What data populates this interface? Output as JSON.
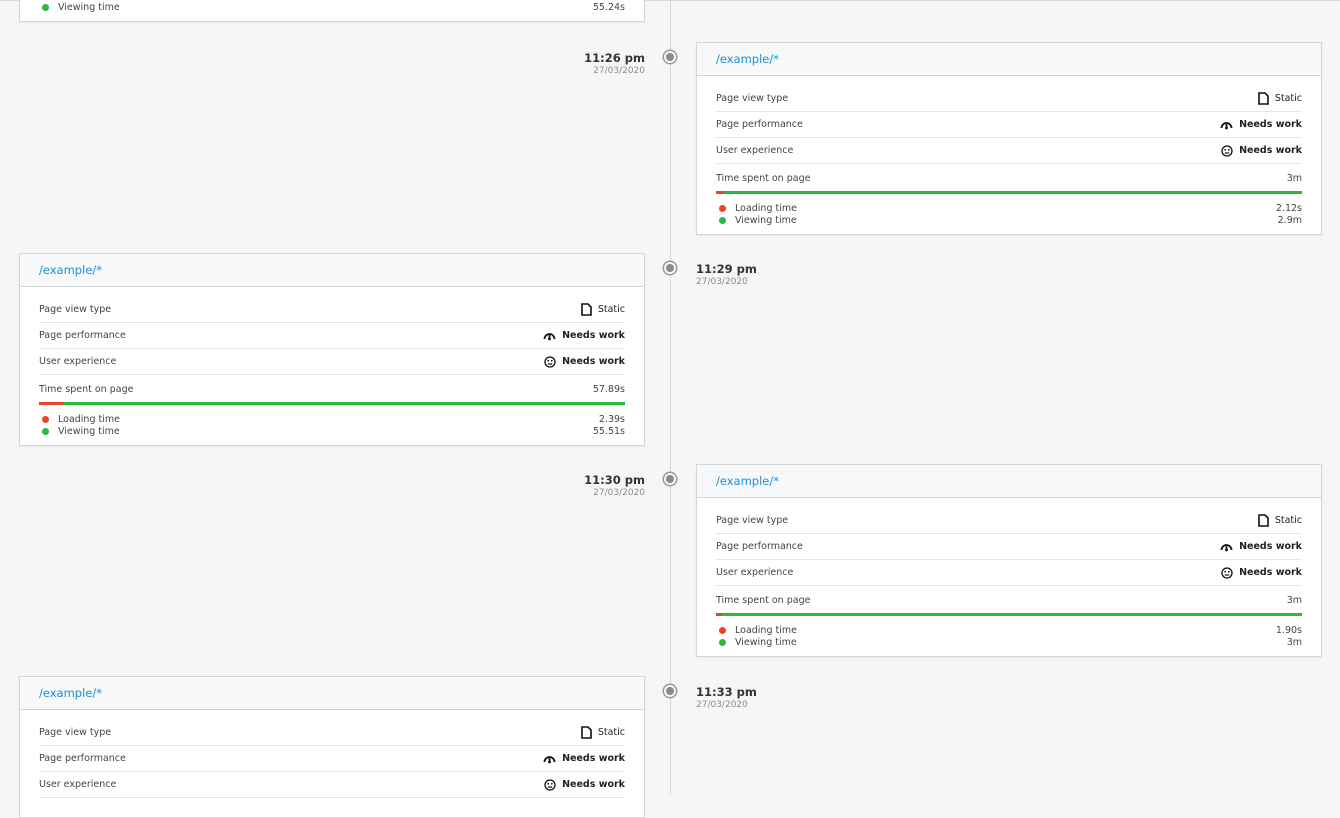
{
  "colors": {
    "link": "#1d8fd6",
    "loading": "#e8442e",
    "viewing": "#2db83d"
  },
  "labels": {
    "page_view_type": "Page view type",
    "page_performance": "Page performance",
    "user_experience": "User experience",
    "time_spent": "Time spent on page",
    "loading_time": "Loading time",
    "viewing_time": "Viewing time"
  },
  "entries": [
    {
      "time": "",
      "date": "",
      "viewing_time": "55.24s"
    },
    {
      "time": "11:26 pm",
      "date": "27/03/2020",
      "url": "/example/*",
      "page_view_type": "Static",
      "page_view_type_icon": "document-icon",
      "page_performance": "Needs work",
      "page_performance_icon": "speedometer-icon",
      "user_experience": "Needs work",
      "user_experience_icon": "neutral-face-icon",
      "time_spent": "3m",
      "loading_time": "2.12s",
      "viewing_time": "2.9m",
      "loading_fraction": 0.012
    },
    {
      "time": "11:29 pm",
      "date": "27/03/2020",
      "url": "/example/*",
      "page_view_type": "Static",
      "page_view_type_icon": "document-icon",
      "page_performance": "Needs work",
      "page_performance_icon": "speedometer-icon",
      "user_experience": "Needs work",
      "user_experience_icon": "neutral-face-icon",
      "time_spent": "57.89s",
      "loading_time": "2.39s",
      "viewing_time": "55.51s",
      "loading_fraction": 0.041
    },
    {
      "time": "11:30 pm",
      "date": "27/03/2020",
      "url": "/example/*",
      "page_view_type": "Static",
      "page_view_type_icon": "document-icon",
      "page_performance": "Needs work",
      "page_performance_icon": "speedometer-icon",
      "user_experience": "Needs work",
      "user_experience_icon": "neutral-face-icon",
      "time_spent": "3m",
      "loading_time": "1.90s",
      "viewing_time": "3m",
      "loading_fraction": 0.011
    },
    {
      "time": "11:33 pm",
      "date": "27/03/2020",
      "url": "/example/*",
      "page_view_type": "Static",
      "page_view_type_icon": "document-icon",
      "page_performance": "Needs work",
      "page_performance_icon": "speedometer-icon",
      "user_experience": "Needs work",
      "user_experience_icon": "neutral-face-icon"
    }
  ]
}
